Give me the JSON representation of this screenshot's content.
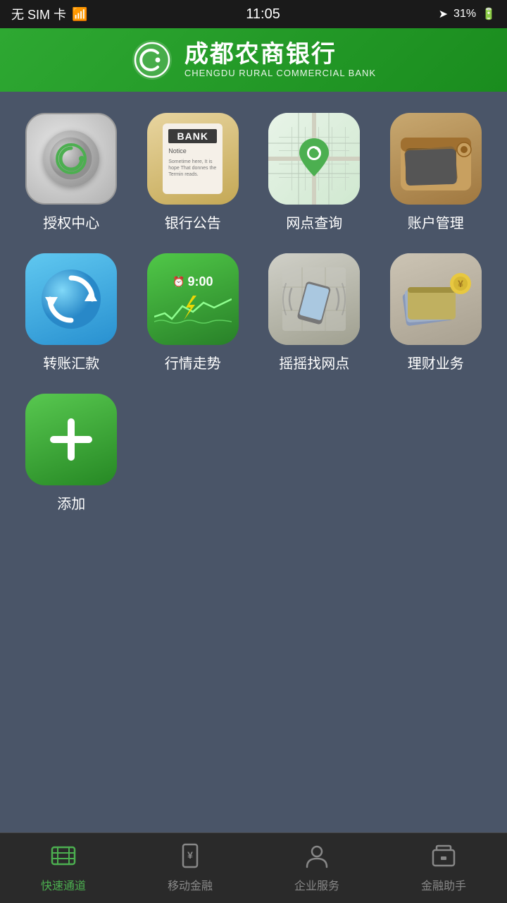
{
  "statusBar": {
    "carrier": "无 SIM 卡",
    "wifi": "WiFi",
    "time": "11:05",
    "location": "▲",
    "battery": "31%"
  },
  "header": {
    "bankNameChinese": "成都农商银行",
    "bankNameEnglish": "CHENGDU RURAL COMMERCIAL BANK"
  },
  "apps": [
    {
      "id": "auth",
      "label": "授权中心",
      "type": "auth"
    },
    {
      "id": "notice",
      "label": "银行公告",
      "type": "notice"
    },
    {
      "id": "location",
      "label": "网点查询",
      "type": "location"
    },
    {
      "id": "account",
      "label": "账户管理",
      "type": "account"
    },
    {
      "id": "transfer",
      "label": "转账汇款",
      "type": "transfer"
    },
    {
      "id": "market",
      "label": "行情走势",
      "type": "market"
    },
    {
      "id": "shake",
      "label": "摇摇找网点",
      "type": "shake"
    },
    {
      "id": "finance",
      "label": "理财业务",
      "type": "finance"
    },
    {
      "id": "add",
      "label": "添加",
      "type": "add"
    }
  ],
  "bottomNav": [
    {
      "id": "quick",
      "label": "快速通道",
      "icon": "🎬",
      "active": true
    },
    {
      "id": "mobile",
      "label": "移动金融",
      "icon": "¥",
      "active": false
    },
    {
      "id": "enterprise",
      "label": "企业服务",
      "icon": "👤",
      "active": false
    },
    {
      "id": "assistant",
      "label": "金融助手",
      "icon": "💼",
      "active": false
    }
  ]
}
